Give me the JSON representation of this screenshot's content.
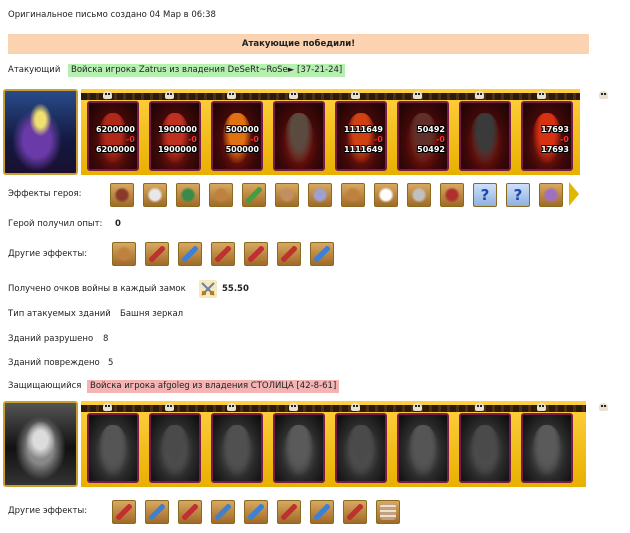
{
  "header": {
    "created": "Оригинальное письмо создано 04 Мар в 06:38"
  },
  "banner": {
    "text": "Атакующие победили!",
    "color": "#fbd3b1"
  },
  "attacker": {
    "label": "Атакующий",
    "name": "Войска игрока Zatrus из владения DeSeRt~RoSe► [37-21-24]",
    "highlight": "#b5f0b0",
    "troops": [
      {
        "top": "6200000",
        "loss": "-0",
        "bottom": "6200000",
        "color": "#b02818"
      },
      {
        "top": "1900000",
        "loss": "-0",
        "bottom": "1900000",
        "color": "#c03020"
      },
      {
        "top": "500000",
        "loss": "-0",
        "bottom": "500000",
        "color": "#e07010"
      },
      {
        "top": "",
        "loss": "",
        "bottom": "",
        "color": "#5a4a40"
      },
      {
        "top": "1111649",
        "loss": "-0",
        "bottom": "1111649",
        "color": "#d04010"
      },
      {
        "top": "50492",
        "loss": "-0",
        "bottom": "50492",
        "color": "#603028"
      },
      {
        "top": "",
        "loss": "",
        "bottom": "",
        "color": "#3a3a3a"
      },
      {
        "top": "17693",
        "loss": "-0",
        "bottom": "17693",
        "color": "#d83010"
      }
    ],
    "hero_effects_label": "Эффекты героя:",
    "hero_effects": [
      {
        "icon": "chest-icon",
        "color": "#8a3a2a"
      },
      {
        "icon": "cards-icon",
        "color": "#e8e8e8"
      },
      {
        "icon": "shield-icon",
        "color": "#3a8a4a"
      },
      {
        "icon": "shield-hand-icon",
        "color": "#c08040"
      },
      {
        "icon": "sword-green-icon",
        "color": "#40a040"
      },
      {
        "icon": "hand-sword-icon",
        "color": "#c09060"
      },
      {
        "icon": "flask-icon",
        "color": "#a0a0d0"
      },
      {
        "icon": "scroll-icon",
        "color": "#c08040"
      },
      {
        "icon": "crystal-icon",
        "color": "#ffffff"
      },
      {
        "icon": "claw-icon",
        "color": "#c0c0c0"
      },
      {
        "icon": "demon-icon",
        "color": "#b03030"
      },
      {
        "icon": "question-icon",
        "color": "#4a8ae0"
      },
      {
        "icon": "question-icon",
        "color": "#4a8ae0"
      },
      {
        "icon": "chain-icon",
        "color": "#a070c0"
      }
    ],
    "xp_label": "Герой получил опыт:",
    "xp_value": "0",
    "other_effects_label": "Другие эффекты:",
    "other_effects": [
      {
        "icon": "scroll-icon",
        "color": "#c08040"
      },
      {
        "icon": "sword-red-icon",
        "color": "#c03030"
      },
      {
        "icon": "sword-blue-icon",
        "color": "#4080d0"
      },
      {
        "icon": "sword-red-icon",
        "color": "#c03030"
      },
      {
        "icon": "sword-red-icon",
        "color": "#c03030"
      },
      {
        "icon": "sword-red-icon",
        "color": "#c03030"
      },
      {
        "icon": "sword-blue-icon",
        "color": "#4080d0"
      }
    ],
    "war_points_label": "Получено очков войны в каждый замок",
    "war_points_value": "55.50",
    "target_label": "Тип атакуемых зданий",
    "target_value": "Башня зеркал",
    "destroyed_label": "Зданий разрушено",
    "destroyed_value": "8",
    "damaged_label": "Зданий повреждено",
    "damaged_value": "5"
  },
  "defender": {
    "label": "Защищающийся",
    "name": "Войска игрока afgoleg из владения СТОЛИЦА [42-8-61]",
    "highlight": "#f4b4b4",
    "troops": [
      {
        "color": "#555555"
      },
      {
        "color": "#4a4a4a"
      },
      {
        "color": "#505050"
      },
      {
        "color": "#5a5a5a"
      },
      {
        "color": "#4a4a4a"
      },
      {
        "color": "#555555"
      },
      {
        "color": "#4a4a4a"
      },
      {
        "color": "#5a5a5a"
      }
    ],
    "other_effects_label": "Другие эффекты:",
    "other_effects": [
      {
        "icon": "sword-red-icon",
        "color": "#c03030"
      },
      {
        "icon": "sword-blue-icon",
        "color": "#4080d0"
      },
      {
        "icon": "sword-red-icon",
        "color": "#c03030"
      },
      {
        "icon": "sword-blue-icon",
        "color": "#4080d0"
      },
      {
        "icon": "sword-blue-icon",
        "color": "#4080d0"
      },
      {
        "icon": "sword-red-icon",
        "color": "#c03030"
      },
      {
        "icon": "sword-blue-icon",
        "color": "#4080d0"
      },
      {
        "icon": "sword-red-icon",
        "color": "#c03030"
      },
      {
        "icon": "wall-icon",
        "color": "#e0d0c0"
      }
    ]
  }
}
